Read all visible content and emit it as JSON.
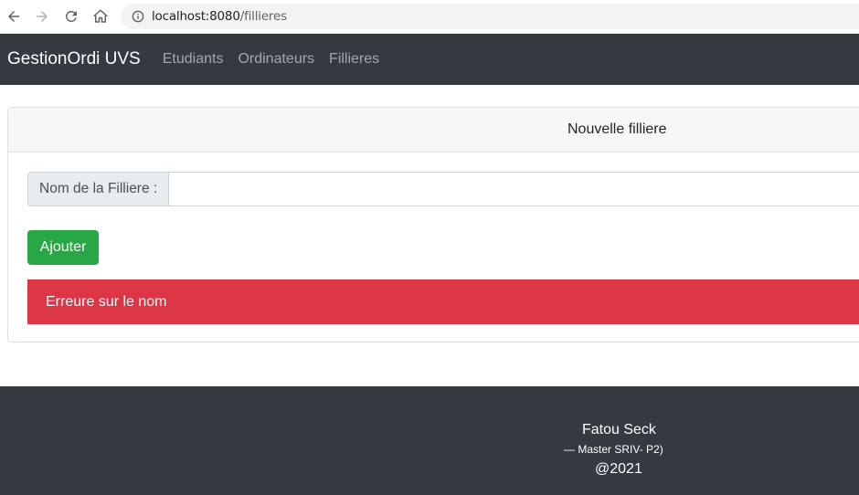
{
  "browser": {
    "url_host": "localhost:8080",
    "url_path": "/fillieres"
  },
  "navbar": {
    "brand": "GestionOrdi UVS",
    "links": [
      "Etudiants",
      "Ordinateurs",
      "Fillieres"
    ]
  },
  "form": {
    "title": "Nouvelle filliere",
    "name_label": "Nom de la Filliere :",
    "name_value": "",
    "submit_label": "Ajouter",
    "error_message": "Erreure sur le nom"
  },
  "footer": {
    "author": "Fatou Seck",
    "subtitle": "—  Master SRIV- P2)",
    "year": "@2021"
  },
  "colors": {
    "navbar_bg": "#343a40",
    "success": "#28a745",
    "danger": "#dc3545"
  }
}
